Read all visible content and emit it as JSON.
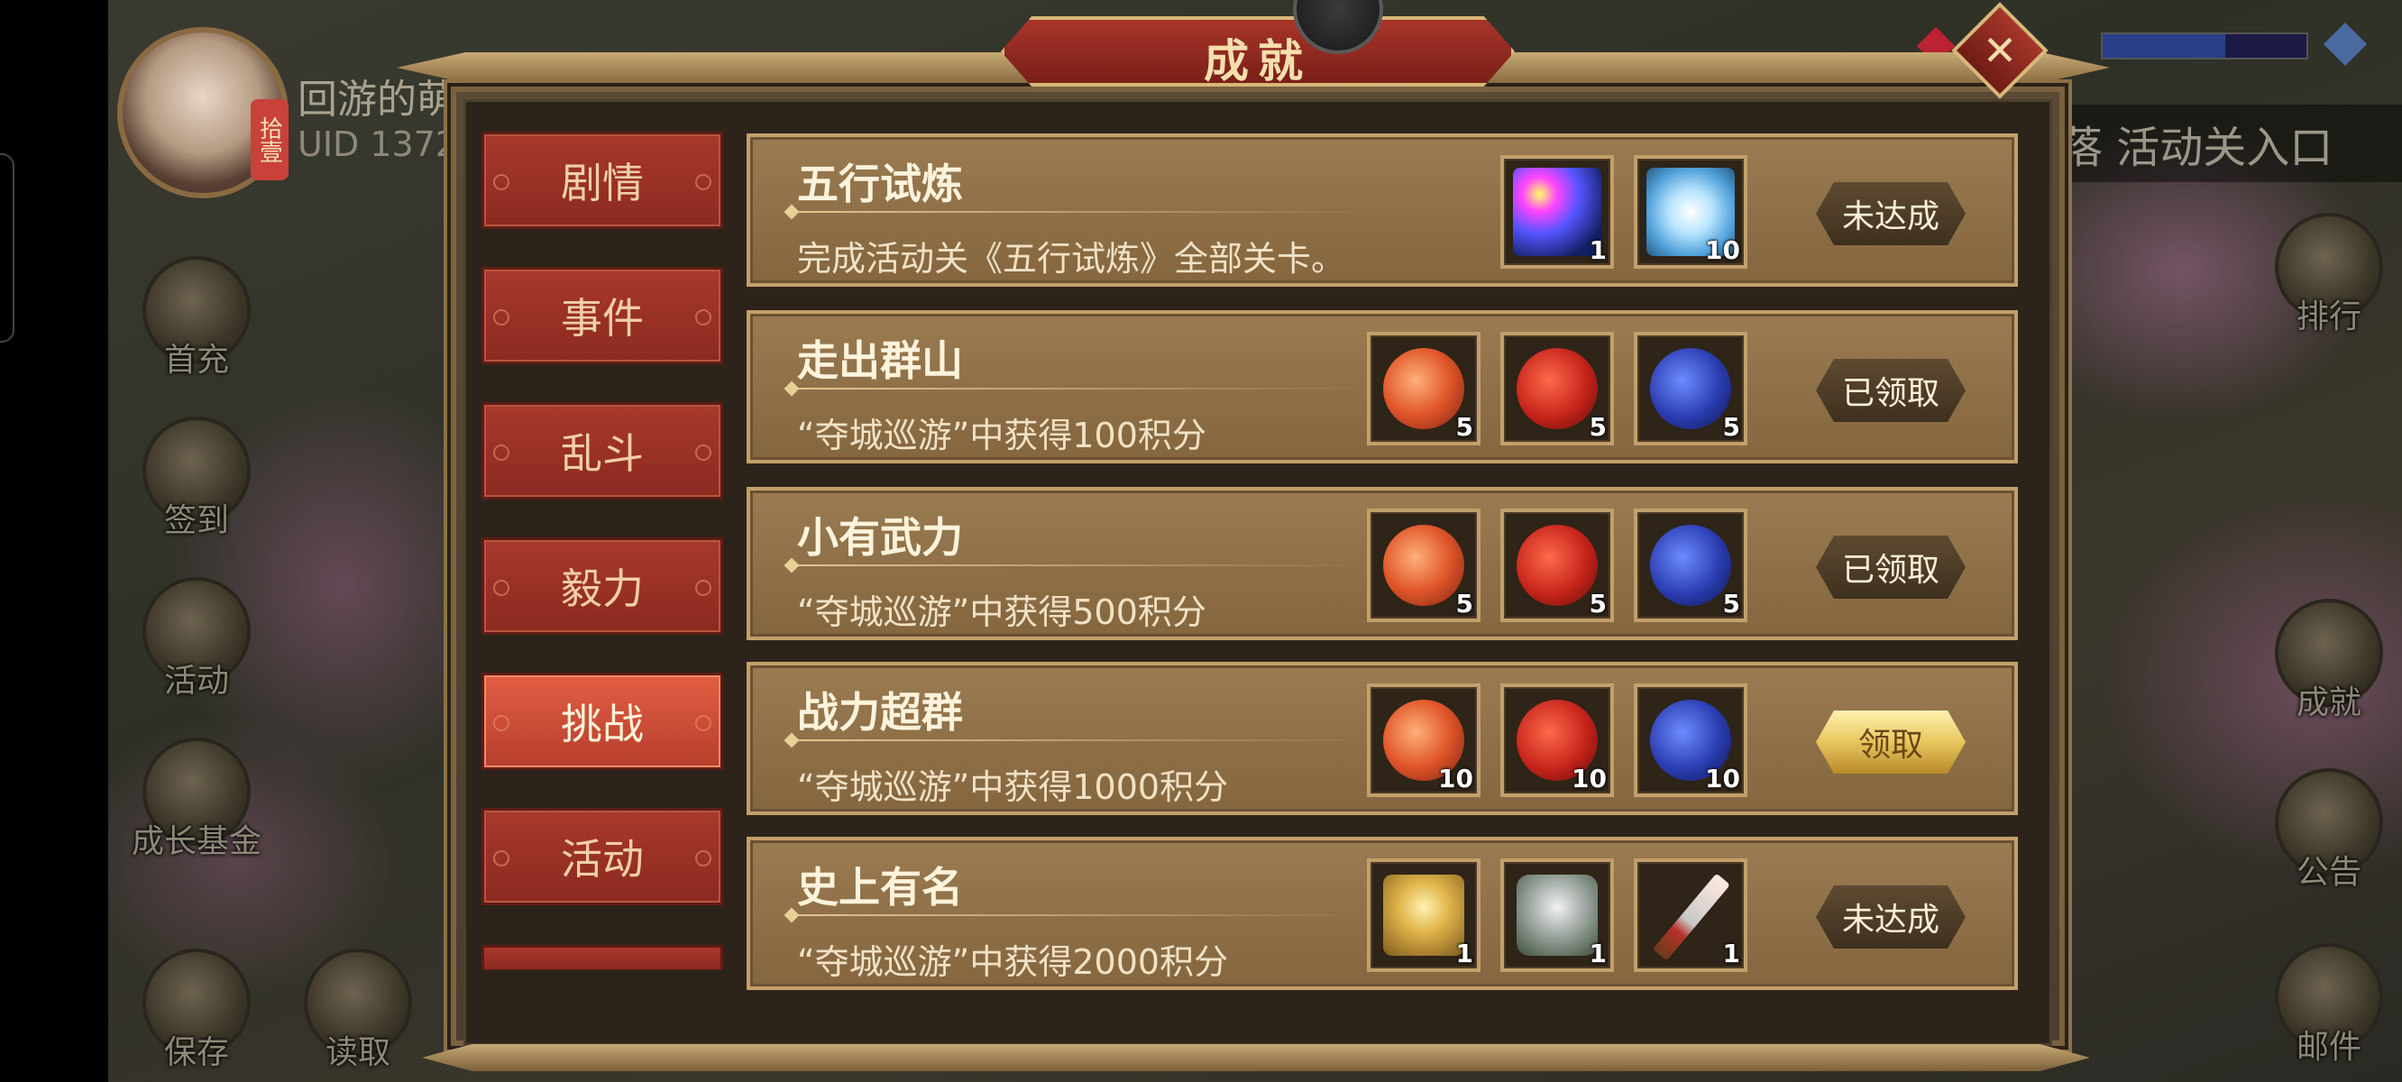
{
  "window": {
    "title": "成就"
  },
  "player": {
    "name": "回游的萌",
    "uid": "UID 1372",
    "avatar_tag": "拾壹"
  },
  "hud_left": [
    {
      "label": "首充",
      "icon": "gift-icon"
    },
    {
      "label": "签到",
      "icon": "signin-icon"
    },
    {
      "label": "活动",
      "icon": "event-icon"
    },
    {
      "label": "成长基金",
      "icon": "fund-icon"
    },
    {
      "label": "保存",
      "icon": "save-icon"
    },
    {
      "label": "读取",
      "icon": "load-icon"
    }
  ],
  "hud_right": [
    {
      "label": "排行",
      "icon": "ranking-icon"
    },
    {
      "label": "成就",
      "icon": "achievement-icon"
    },
    {
      "label": "公告",
      "icon": "notice-icon"
    },
    {
      "label": "邮件",
      "icon": "mail-icon"
    }
  ],
  "entry_banner": "落 活动关入口",
  "tabs": [
    {
      "label": "剧情",
      "active": false
    },
    {
      "label": "事件",
      "active": false
    },
    {
      "label": "乱斗",
      "active": false
    },
    {
      "label": "毅力",
      "active": false
    },
    {
      "label": "挑战",
      "active": true
    },
    {
      "label": "活动",
      "active": false
    }
  ],
  "achievements": [
    {
      "title": "五行试炼",
      "description": "完成活动关《五行试炼》全部关卡。",
      "status": "未达成",
      "rewards": [
        {
          "icon": "star-orb-icon",
          "qty": "1"
        },
        {
          "icon": "ice-crystal-icon",
          "qty": "10"
        }
      ]
    },
    {
      "title": "走出群山",
      "description": "“夺城巡游”中获得100积分",
      "status": "已领取",
      "rewards": [
        {
          "icon": "peach-icon",
          "qty": "5"
        },
        {
          "icon": "red-fruit-icon",
          "qty": "5"
        },
        {
          "icon": "plum-icon",
          "qty": "5"
        }
      ]
    },
    {
      "title": "小有武力",
      "description": "“夺城巡游”中获得500积分",
      "status": "已领取",
      "rewards": [
        {
          "icon": "peach-icon",
          "qty": "5"
        },
        {
          "icon": "red-fruit-icon",
          "qty": "5"
        },
        {
          "icon": "plum-icon",
          "qty": "5"
        }
      ]
    },
    {
      "title": "战力超群",
      "description": "“夺城巡游”中获得1000积分",
      "status": "领取",
      "rewards": [
        {
          "icon": "peach-icon",
          "qty": "10"
        },
        {
          "icon": "red-fruit-icon",
          "qty": "10"
        },
        {
          "icon": "plum-icon",
          "qty": "10"
        }
      ]
    },
    {
      "title": "史上有名",
      "description": "“夺城巡游”中获得2000积分",
      "status": "未达成",
      "rewards": [
        {
          "icon": "golden-statue-icon",
          "qty": "1"
        },
        {
          "icon": "armor-icon",
          "qty": "1"
        },
        {
          "icon": "dagger-icon",
          "qty": "1"
        }
      ]
    }
  ],
  "close_symbol": "✕"
}
